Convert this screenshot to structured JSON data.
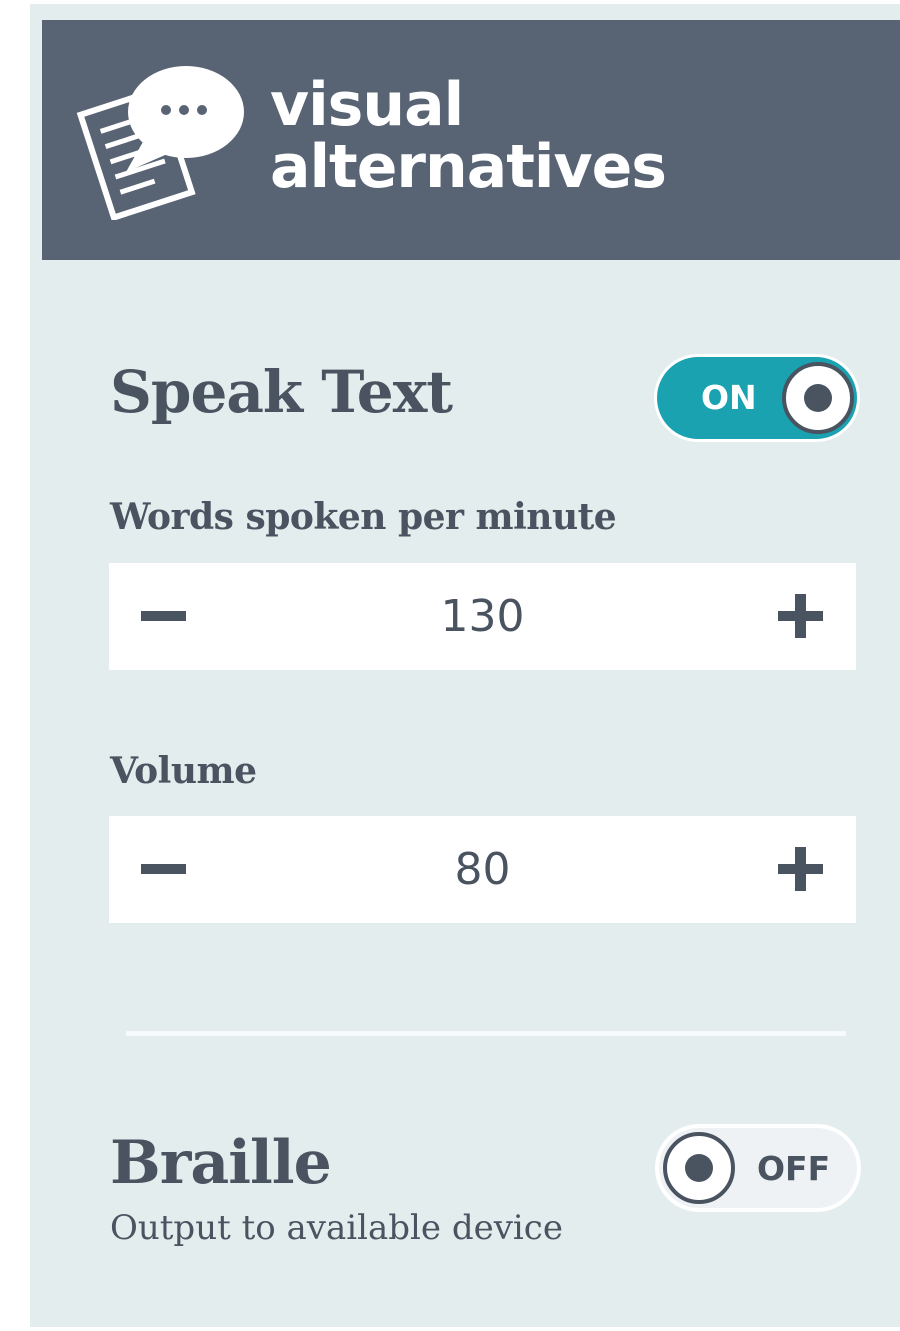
{
  "header": {
    "title_line1": "visual",
    "title_line2": "alternatives",
    "icon": "speech-bubble-document-icon",
    "background_color": "#586373"
  },
  "speak_text": {
    "title": "Speak Text",
    "toggle": {
      "state": "on",
      "label": "ON",
      "color": "#1aa2b1"
    },
    "words_per_minute": {
      "label": "Words spoken per minute",
      "value": "130",
      "decrement_icon": "minus-icon",
      "increment_icon": "plus-icon"
    },
    "volume": {
      "label": "Volume",
      "value": "80",
      "decrement_icon": "minus-icon",
      "increment_icon": "plus-icon"
    }
  },
  "braille": {
    "title": "Braille",
    "subtitle": "Output to available device",
    "toggle": {
      "state": "off",
      "label": "OFF"
    }
  },
  "colors": {
    "panel_background": "#e3edee",
    "text": "#4a5360",
    "accent": "#1aa2b1"
  }
}
